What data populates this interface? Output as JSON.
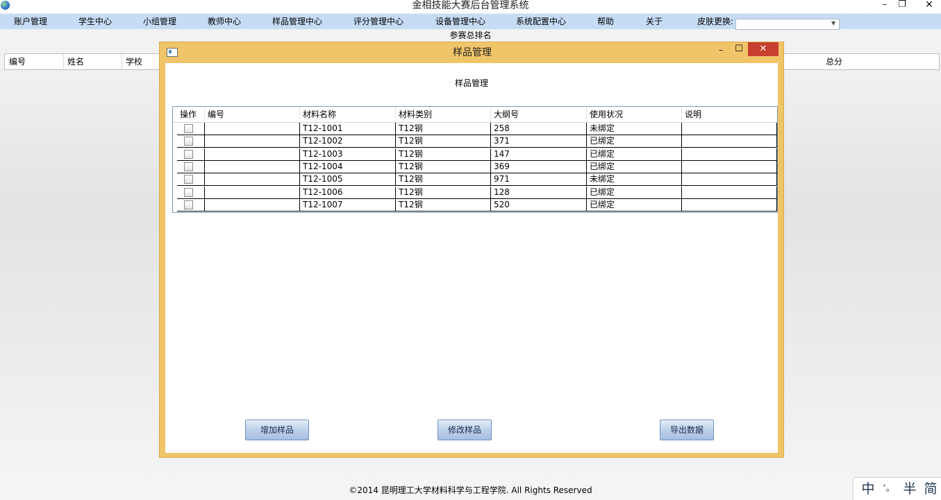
{
  "window": {
    "title": "金相技能大赛后台管理系统",
    "min_symbol": "–",
    "restore_symbol": "❐",
    "close_symbol": "✕"
  },
  "menu": {
    "items": [
      "账户管理",
      "学生中心",
      "小组管理",
      "教师中心",
      "样品管理中心",
      "评分管理中心",
      "设备管理中心",
      "系统配置中心",
      "帮助",
      "关于"
    ],
    "skin_label": "皮肤更换:",
    "skin_value": ""
  },
  "ranking": {
    "title": "参赛总排名",
    "columns": [
      "编号",
      "姓名",
      "学校",
      "总分"
    ]
  },
  "dialog": {
    "title": "样品管理",
    "heading": "样品管理",
    "min_symbol": "–",
    "max_symbol": "☐",
    "close_symbol": "✕",
    "table": {
      "headers": [
        "操作",
        "编号",
        "材料名称",
        "材料类别",
        "大纲号",
        "使用状况",
        "说明"
      ],
      "rows": [
        {
          "id": "",
          "name": "T12-1001",
          "category": "T12钢",
          "outline": "258",
          "status": "未绑定",
          "note": ""
        },
        {
          "id": "",
          "name": "T12-1002",
          "category": "T12钢",
          "outline": "371",
          "status": "已绑定",
          "note": ""
        },
        {
          "id": "",
          "name": "T12-1003",
          "category": "T12钢",
          "outline": "147",
          "status": "已绑定",
          "note": ""
        },
        {
          "id": "",
          "name": "T12-1004",
          "category": "T12钢",
          "outline": "369",
          "status": "已绑定",
          "note": ""
        },
        {
          "id": "",
          "name": "T12-1005",
          "category": "T12钢",
          "outline": "971",
          "status": "未绑定",
          "note": ""
        },
        {
          "id": "",
          "name": "T12-1006",
          "category": "T12钢",
          "outline": "128",
          "status": "已绑定",
          "note": ""
        },
        {
          "id": "",
          "name": "T12-1007",
          "category": "T12钢",
          "outline": "520",
          "status": "已绑定",
          "note": ""
        }
      ]
    },
    "buttons": {
      "add": "增加样品",
      "edit": "修改样品",
      "export": "导出数据"
    }
  },
  "footer": "©2014 昆明理工大学材料科学与工程学院. All Rights Reserved",
  "ime": [
    "中",
    "ʻ。",
    "半",
    "简"
  ]
}
